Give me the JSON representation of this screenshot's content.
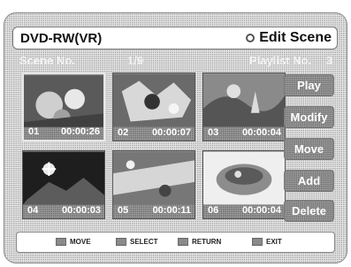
{
  "header": {
    "app_title": "DVD-RW(VR)",
    "mode_title": "Edit Scene",
    "mode_icon": "disc-icon"
  },
  "info": {
    "scene_label": "Scene No.",
    "scene_index": "1/9",
    "playlist_label": "Playlist No.",
    "playlist_number": "3"
  },
  "scenes": [
    {
      "number": "01",
      "time": "00:00:26",
      "selected": true
    },
    {
      "number": "02",
      "time": "00:00:07",
      "selected": false
    },
    {
      "number": "03",
      "time": "00:00:04",
      "selected": false
    },
    {
      "number": "04",
      "time": "00:00:03",
      "selected": false
    },
    {
      "number": "05",
      "time": "00:00:11",
      "selected": false
    },
    {
      "number": "06",
      "time": "00:00:04",
      "selected": false
    }
  ],
  "buttons": {
    "play": "Play",
    "modify": "Modify",
    "move": "Move",
    "add": "Add",
    "delete": "Delete"
  },
  "footer": {
    "move": "MOVE",
    "select": "SELECT",
    "return": "RETURN",
    "exit": "EXIT"
  }
}
